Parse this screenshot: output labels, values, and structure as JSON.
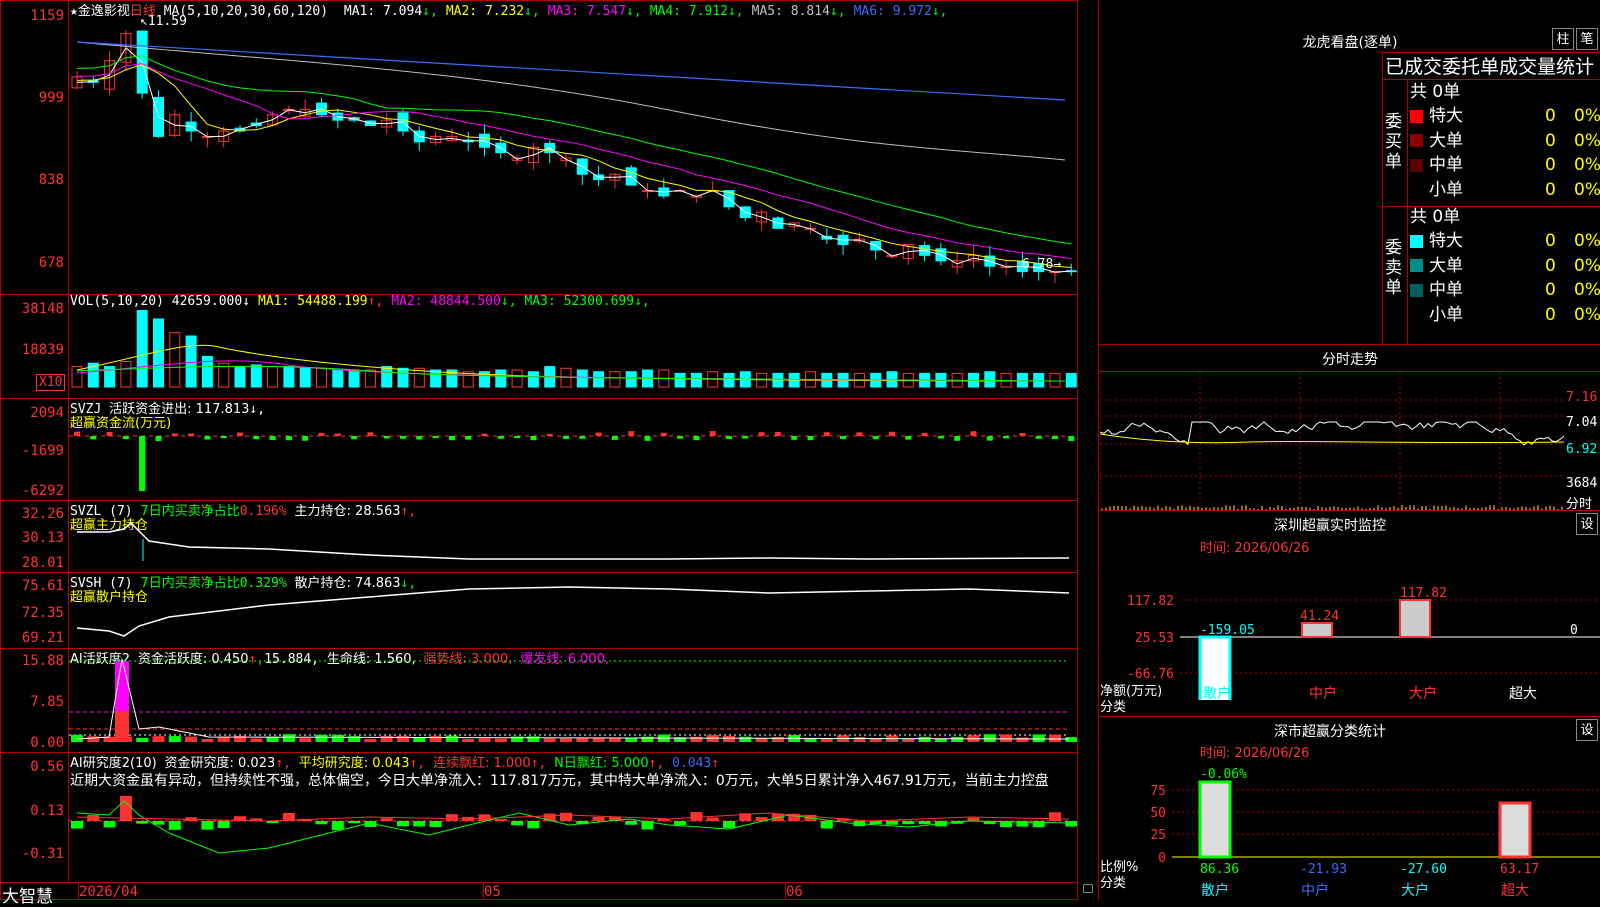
{
  "app": {
    "brand": "大智慧"
  },
  "kline": {
    "star": "★",
    "stock_name": "金逸影视",
    "period": "日线",
    "ma_label": "MA(5,10,20,30,60,120)",
    "mas": [
      {
        "name": "MA1:",
        "value": "7.094",
        "arrow": "↓",
        "color": "#ffffff"
      },
      {
        "name": "MA2:",
        "value": "7.232",
        "arrow": "↓",
        "color": "#ffff00"
      },
      {
        "name": "MA3:",
        "value": "7.547",
        "arrow": "↓",
        "color": "#ff00ff"
      },
      {
        "name": "MA4:",
        "value": "7.912",
        "arrow": "↓",
        "color": "#00ff00"
      },
      {
        "name": "MA5:",
        "value": "8.814",
        "arrow": "↓",
        "color": "#c0c0c0"
      },
      {
        "name": "MA6:",
        "value": "9.972",
        "arrow": "↓",
        "color": "#3b6bff"
      }
    ],
    "axis": [
      "1159",
      "999",
      "838",
      "678"
    ],
    "high_label": "11.59",
    "low_label": "6.78"
  },
  "vol": {
    "label": "VOL(5,10,20)",
    "value": "42659.000",
    "arrow": "↓",
    "mas": [
      {
        "name": "MA1:",
        "value": "54488.199",
        "arrow": "↑",
        "color": "#ffff00"
      },
      {
        "name": "MA2:",
        "value": "48844.500",
        "arrow": "↓",
        "color": "#ff00ff"
      },
      {
        "name": "MA3:",
        "value": "52300.699",
        "arrow": "↓",
        "color": "#00ff00"
      }
    ],
    "axis": [
      "38148",
      "18839"
    ],
    "unit": "X10"
  },
  "svzj": {
    "label": "SVZJ",
    "line1": "活跃资金进出: 117.813",
    "arrow": "↓,",
    "line2": "超赢资金流(万元)",
    "axis": [
      "2094",
      "-1699",
      "-6292"
    ]
  },
  "svzl": {
    "label": "SVZL (7)",
    "text_green": "7日内买卖净占比",
    "text_red": "0.196%",
    "text_white": "主力持仓: 28.563",
    "arrow": "↑,",
    "line2": "超赢主力持仓",
    "axis": [
      "32.26",
      "30.13",
      "28.01"
    ]
  },
  "svsh": {
    "label": "SVSH (7)",
    "text_green": "7日内买卖净占比",
    "text_red": "0.329%",
    "text_white": "散户持仓: 74.863",
    "arrow": "↓,",
    "line2": "超赢散户持仓",
    "axis": [
      "75.61",
      "72.35",
      "69.21"
    ]
  },
  "ai_active": {
    "label": "AI活跃度2",
    "text1": "资金活跃度: 0.450",
    "arrow1": "↑,",
    "text2": "15.884,",
    "text3": "生命线: 1.560,",
    "text4": "强势线: 3.000,",
    "text5": "爆发线: 6.000,",
    "axis": [
      "15.88",
      "7.85",
      "0.00"
    ]
  },
  "ai_research": {
    "label": "AI研究度2(10)",
    "t1": "资金研究度: 0.023",
    "a1": "↑,",
    "t2": "平均研究度: 0.043",
    "a2": "↑,",
    "t3": "连续飘红: 1.000",
    "a3": "↑,",
    "t4": "N日飘红: 5.000",
    "a4": "↑,",
    "t5": "0.043",
    "a5": "↑",
    "comment": "近期大资金虽有异动，但持续性不强，总体偏空，今日大单净流入：117.817万元，其中特大单净流入：0万元，大单5日累计净入467.91万元，当前主力控盘",
    "axis": [
      "0.56",
      "0.13",
      "-0.31"
    ]
  },
  "date_axis": [
    "2026/04",
    "05",
    "06"
  ],
  "right": {
    "title": "龙虎看盘(逐单)",
    "btn_bar": "柱",
    "btn_pen": "笔",
    "order_title": "已成交委托单成交量统计",
    "buy": {
      "side": "委买单",
      "total": "共 0单",
      "rows": [
        {
          "label": "特大",
          "count": "0",
          "pct": "0%",
          "color": "#ff0000"
        },
        {
          "label": "大单",
          "count": "0",
          "pct": "0%",
          "color": "#8b0000"
        },
        {
          "label": "中单",
          "count": "0",
          "pct": "0%",
          "color": "#5a0000"
        },
        {
          "label": "小单",
          "count": "0",
          "pct": "0%",
          "color": "#000000"
        }
      ]
    },
    "sell": {
      "side": "委卖单",
      "total": "共 0单",
      "rows": [
        {
          "label": "特大",
          "count": "0",
          "pct": "0%",
          "color": "#00ffff"
        },
        {
          "label": "大单",
          "count": "0",
          "pct": "0%",
          "color": "#008b8b"
        },
        {
          "label": "中单",
          "count": "0",
          "pct": "0%",
          "color": "#006060"
        },
        {
          "label": "小单",
          "count": "0",
          "pct": "0%",
          "color": "#000000"
        }
      ]
    },
    "intraday": {
      "title": "分时走势",
      "axis": [
        "7.16",
        "7.04",
        "6.92"
      ],
      "vol_value": "3684",
      "vol_label": "分时"
    },
    "monitor": {
      "title": "深圳超赢实时监控",
      "btn": "设",
      "time": "时间: 2026/06/26",
      "axis": [
        "117.82",
        "25.53",
        "-66.76",
        "-159.05"
      ],
      "y_label": "净额(万元)",
      "x_label": "分类",
      "categories": [
        "散户",
        "中户",
        "大户",
        "超大"
      ],
      "values_text": [
        "-159.05",
        "41.24",
        "117.82",
        "0"
      ]
    },
    "classify": {
      "title": "深市超赢分类统计",
      "btn": "设",
      "time": "时间: 2026/06/26",
      "axis": [
        "75",
        "50",
        "25",
        "0"
      ],
      "top_label": "-0.06%",
      "y_label": "比例%",
      "x_label": "分类",
      "categories": [
        "散户",
        "中户",
        "大户",
        "超大"
      ],
      "values_text": [
        "86.36",
        "-21.93",
        "-27.60",
        "63.17"
      ]
    }
  }
}
